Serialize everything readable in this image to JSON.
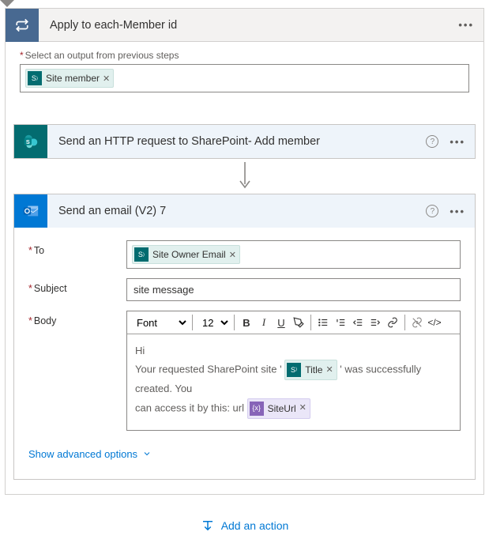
{
  "loop": {
    "title": "Apply to each-Member id",
    "field_label": "Select an output from previous steps",
    "pill_label": "Site member"
  },
  "http": {
    "title": "Send an HTTP request to SharePoint- Add member"
  },
  "email": {
    "title": "Send an email (V2) 7",
    "to_label": "To",
    "to_pill": "Site Owner Email",
    "subject_label": "Subject",
    "subject_value": "site message",
    "body_label": "Body",
    "toolbar": {
      "font": "Font",
      "size": "12"
    },
    "body_text": {
      "line1": "Hi",
      "line2_a": "Your requested SharePoint site '",
      "title_pill": "Title",
      "line2_b": "' was successfully created. You",
      "line3_a": "can access it by  this: url",
      "url_pill": "SiteUrl"
    },
    "advanced": "Show advanced options"
  },
  "footer": {
    "add_action": "Add an action"
  }
}
